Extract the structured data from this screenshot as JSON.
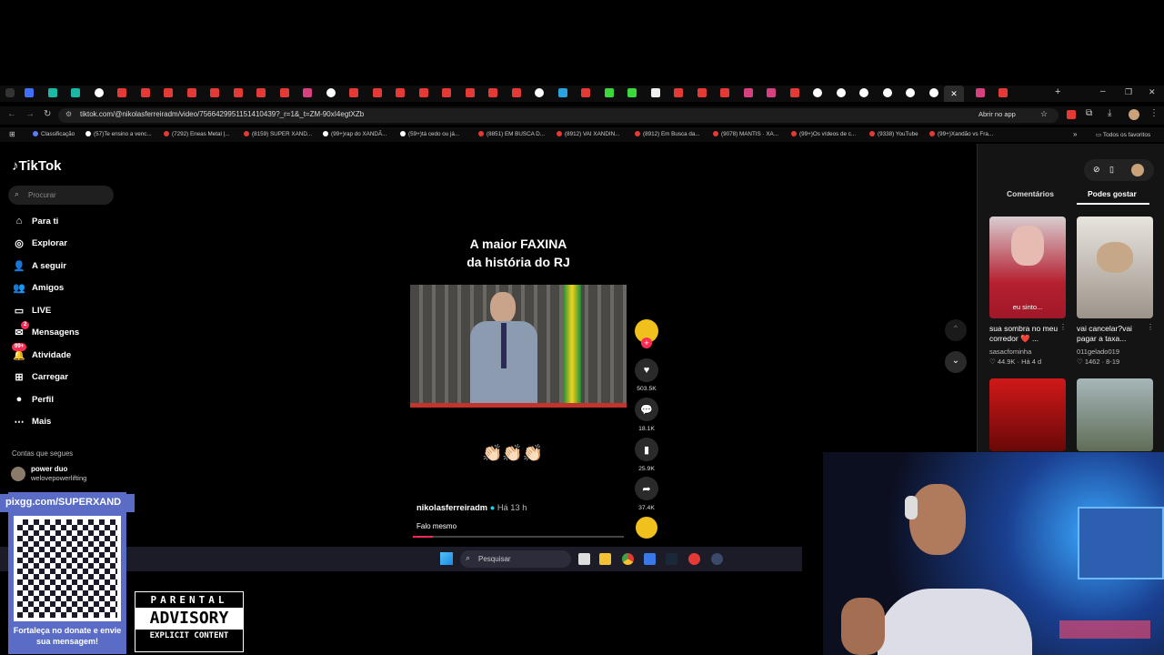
{
  "browser": {
    "url": "tiktok.com/@nikolasferreiradm/video/7566429951151410439?_r=1&_t=ZM-90xI4egtXZb",
    "open_app_label": "Abrir no app",
    "bookmarks": [
      "Classificação",
      "(57)Te ensino a venc...",
      "(7292) Eneas Metal |...",
      "(8159) SUPER XAND...",
      "(99+)rap do XANDÃ...",
      "(59+)tá cedo ou já...",
      "(8851) EM BUSCA D...",
      "(8912) VAI XANDIN...",
      "(8912) Em Busca da...",
      "(9078) MANTIS · XA...",
      "(99+)Os vídeos de c...",
      "(9338) YouTube",
      "(99+)Xandão vs Fra..."
    ],
    "all_favorites": "Todos os favoritos"
  },
  "tiktok": {
    "logo": "TikTok",
    "search_placeholder": "Procurar",
    "nav": [
      {
        "label": "Para ti",
        "icon": "home-icon"
      },
      {
        "label": "Explorar",
        "icon": "compass-icon"
      },
      {
        "label": "A seguir",
        "icon": "following-icon"
      },
      {
        "label": "Amigos",
        "icon": "friends-icon"
      },
      {
        "label": "LIVE",
        "icon": "live-icon"
      },
      {
        "label": "Mensagens",
        "icon": "messages-icon"
      },
      {
        "label": "Atividade",
        "icon": "activity-icon"
      },
      {
        "label": "Carregar",
        "icon": "upload-icon"
      },
      {
        "label": "Perfil",
        "icon": "profile-icon"
      },
      {
        "label": "Mais",
        "icon": "more-icon"
      }
    ],
    "messages_badge": "2",
    "activity_badge": "99+",
    "following_header": "Contas que segues",
    "following_account": {
      "name": "power duo",
      "handle": "welovepowerlifting"
    }
  },
  "video": {
    "caption_line1": "A maior FAXINA",
    "caption_line2": "da história do RJ",
    "emojis": "👏🏻👏🏻👏🏻",
    "author": "nikolasferreiradm",
    "time": "Há 13 h",
    "description": "Falo mesmo",
    "likes": "503.5K",
    "comments": "18.1K",
    "saves": "25.9K",
    "shares": "37.4K"
  },
  "right_panel": {
    "tab_comments": "Comentários",
    "tab_like": "Podes gostar",
    "cards": [
      {
        "title": "sua sombra no meu corredor ❤️ ...",
        "user": "sasacfominha",
        "likes": "44.9K",
        "time": "Há 4 d",
        "overlay": "eu sinto..."
      },
      {
        "title": "vai cancelar?vai pagar a taxa...",
        "user": "011gelado019",
        "likes": "1462",
        "time": "8-19",
        "overlay": ""
      }
    ]
  },
  "taskbar": {
    "search_placeholder": "Pesquisar"
  },
  "overlay": {
    "pix_url": "pixgg.com/SUPERXAND",
    "donate_text": "Fortaleça no donate e envie sua mensagem!",
    "advisory_top": "PARENTAL",
    "advisory_mid": "ADVISORY",
    "advisory_bot": "EXPLICIT CONTENT"
  },
  "colors": {
    "accent": "#fe2c55",
    "verified": "#20d5ec",
    "taskbar": "#1c1c28",
    "qr_bg": "#5a6cc6"
  }
}
